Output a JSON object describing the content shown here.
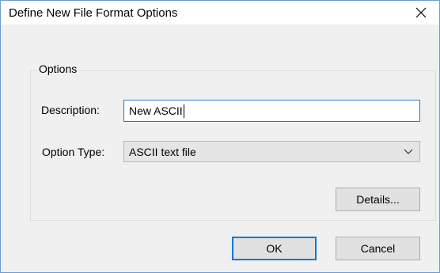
{
  "window": {
    "title": "Define New File Format Options"
  },
  "options_group": {
    "legend": "Options",
    "description_label": "Description:",
    "description_value": "New ASCII",
    "option_type_label": "Option Type:",
    "option_type_selected": "ASCII text file",
    "details_button": "Details..."
  },
  "footer": {
    "ok_button": "OK",
    "cancel_button": "Cancel"
  },
  "icons": {
    "close": "close-icon",
    "dropdown": "chevron-down-icon"
  },
  "colors": {
    "accent": "#0078d7",
    "window_border": "#6b9bd6",
    "dialog_bg": "#f0f0f0"
  }
}
